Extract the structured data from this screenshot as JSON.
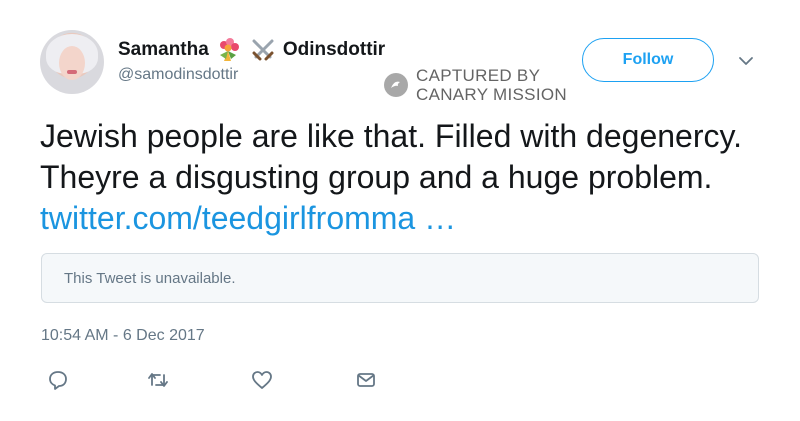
{
  "user": {
    "name_first": "Samantha",
    "name_last": "Odinsdottir",
    "handle": "@samodinsdottir",
    "emojis": [
      "bouquet-icon",
      "crossed-swords-icon"
    ]
  },
  "follow_button": {
    "label": "Follow"
  },
  "watermark": {
    "line1": "CAPTURED BY",
    "line2": "CANARY MISSION"
  },
  "tweet": {
    "text": "Jewish people are like that. Filled with degenercy. Theyre a disgusting group and a huge problem.",
    "link_text": "twitter.com/teedgirlfromma …"
  },
  "quote": {
    "text": "This Tweet is unavailable."
  },
  "timestamp": "10:54 AM - 6 Dec 2017",
  "actions": [
    "reply-icon",
    "retweet-icon",
    "like-icon",
    "direct-message-icon"
  ],
  "colors": {
    "accent": "#1da1f2",
    "link": "#1b95e0",
    "muted": "#657786",
    "text": "#14171a"
  }
}
